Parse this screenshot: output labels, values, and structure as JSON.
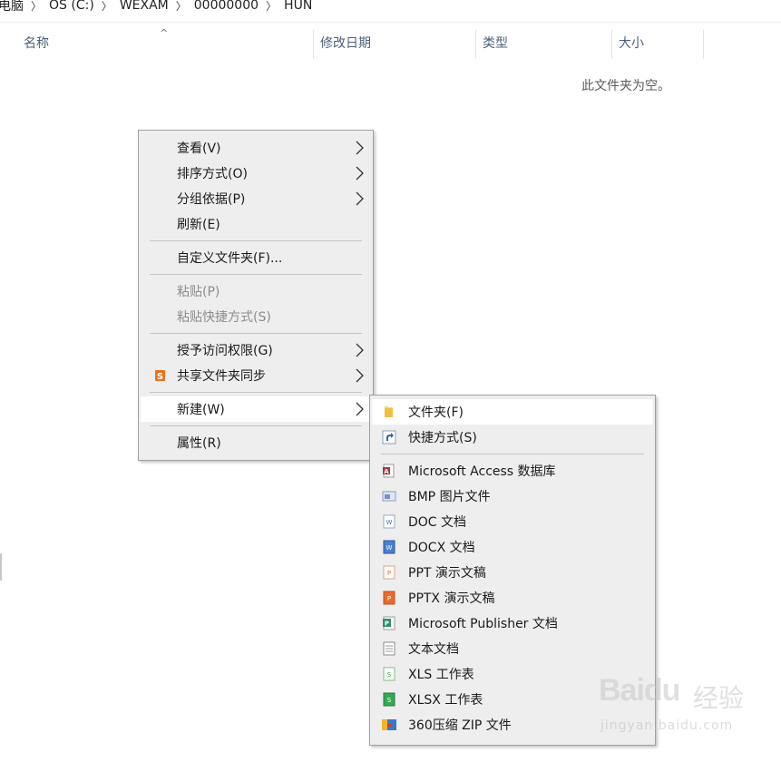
{
  "breadcrumb": {
    "segments": [
      "此电脑",
      "OS (C:)",
      "WEXAM",
      "00000000",
      "HUN"
    ]
  },
  "columns": {
    "name": "名称",
    "date": "修改日期",
    "type": "类型",
    "size": "大小"
  },
  "empty_message": "此文件夹为空。",
  "context_menu": {
    "view": "查看(V)",
    "sort": "排序方式(O)",
    "group": "分组依据(P)",
    "refresh": "刷新(E)",
    "customize": "自定义文件夹(F)...",
    "paste": "粘贴(P)",
    "paste_shortcut": "粘贴快捷方式(S)",
    "give_access": "授予访问权限(G)",
    "shared_sync": "共享文件夹同步",
    "new": "新建(W)",
    "properties": "属性(R)"
  },
  "new_submenu": {
    "folder": "文件夹(F)",
    "shortcut": "快捷方式(S)",
    "access": "Microsoft Access 数据库",
    "bmp": "BMP 图片文件",
    "doc": "DOC 文档",
    "docx": "DOCX 文档",
    "ppt": "PPT 演示文稿",
    "pptx": "PPTX 演示文稿",
    "publisher": "Microsoft Publisher 文档",
    "txt": "文本文档",
    "xls": "XLS 工作表",
    "xlsx": "XLSX 工作表",
    "zip": "360压缩 ZIP 文件"
  },
  "watermark": {
    "brand": "Baidu",
    "cn": "经验",
    "url": "jingyan.baidu.com"
  },
  "colors": {
    "menu_bg": "#eeeeee",
    "header_text": "#4c607a",
    "highlight": "#ffffff"
  }
}
